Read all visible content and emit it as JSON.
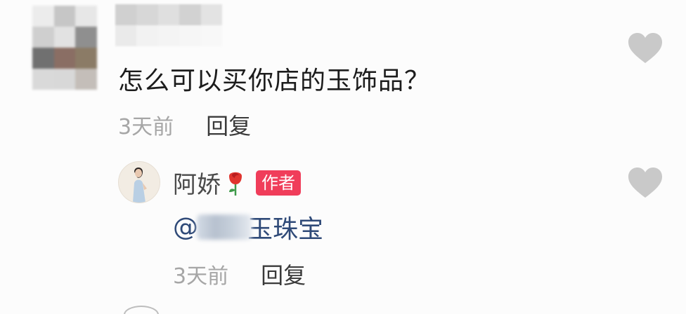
{
  "comments": [
    {
      "text": "怎么可以买你店的玉饰品？",
      "time": "3天前",
      "reply_label": "回复",
      "avatar_icon": "pixelated-avatar-icon",
      "avatar_pixels": [
        "#ececec",
        "#c6c6c6",
        "#e7e7e7",
        "#cfcfcf",
        "#e2e2e2",
        "#8f8f8f",
        "#707070",
        "#8a6e64",
        "#8b7b66",
        "#d9d9d9",
        "#d8d8d8",
        "#c4beb9"
      ],
      "name_pixels": [
        "#d0d0d0",
        "#d7d7d7",
        "#dfdfdf",
        "#d2d2d2",
        "#e3e3e3",
        "#eaeaea",
        "#f2f2f2",
        "#f4f4f4",
        "#f6f6f6",
        "#f8f8f8"
      ]
    },
    {
      "author": "阿娇",
      "author_emoji": "rose-icon",
      "badge": "作者",
      "mention_prefix": "@",
      "mention_suffix": "玉珠宝",
      "time": "3天前",
      "reply_label": "回复"
    }
  ],
  "colors": {
    "badge_bg": "#f03d5a",
    "mention": "#2f4a78",
    "heart": "#c9c9c9",
    "time": "#a6a6a6"
  }
}
